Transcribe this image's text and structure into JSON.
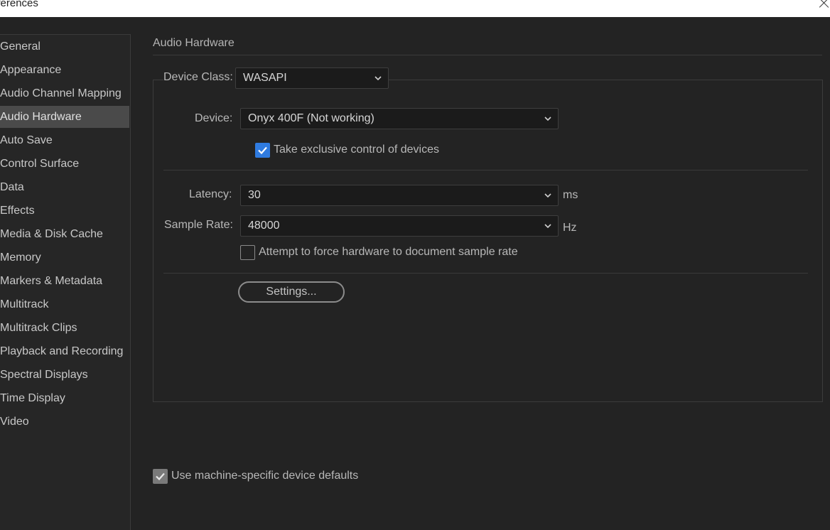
{
  "window": {
    "title": "eferences",
    "close_icon": "close-icon"
  },
  "sidebar": {
    "selected": "Audio Hardware",
    "items": [
      {
        "label": "General"
      },
      {
        "label": "Appearance"
      },
      {
        "label": "Audio Channel Mapping"
      },
      {
        "label": "Audio Hardware"
      },
      {
        "label": "Auto Save"
      },
      {
        "label": "Control Surface"
      },
      {
        "label": "Data"
      },
      {
        "label": "Effects"
      },
      {
        "label": "Media & Disk Cache"
      },
      {
        "label": "Memory"
      },
      {
        "label": "Markers & Metadata"
      },
      {
        "label": "Multitrack"
      },
      {
        "label": "Multitrack Clips"
      },
      {
        "label": "Playback and Recording"
      },
      {
        "label": "Spectral Displays"
      },
      {
        "label": "Time Display"
      },
      {
        "label": "Video"
      }
    ]
  },
  "main": {
    "section_title": "Audio Hardware",
    "device_class": {
      "label": "Device Class:",
      "value": "WASAPI"
    },
    "device": {
      "label": "Device:",
      "value": "Onyx 400F (Not working)"
    },
    "exclusive": {
      "label": "Take exclusive control of devices",
      "checked": true
    },
    "latency": {
      "label": "Latency:",
      "value": "30",
      "unit": "ms"
    },
    "sample_rate": {
      "label": "Sample Rate:",
      "value": "48000",
      "unit": "Hz"
    },
    "force_rate": {
      "label": "Attempt to force hardware to document sample rate",
      "checked": false
    },
    "settings_button": "Settings...",
    "machine_defaults": {
      "label": "Use machine-specific device defaults",
      "checked": true
    }
  },
  "colors": {
    "accent": "#2f7be0",
    "background": "#232323",
    "selected_item": "#4a4a4a"
  }
}
